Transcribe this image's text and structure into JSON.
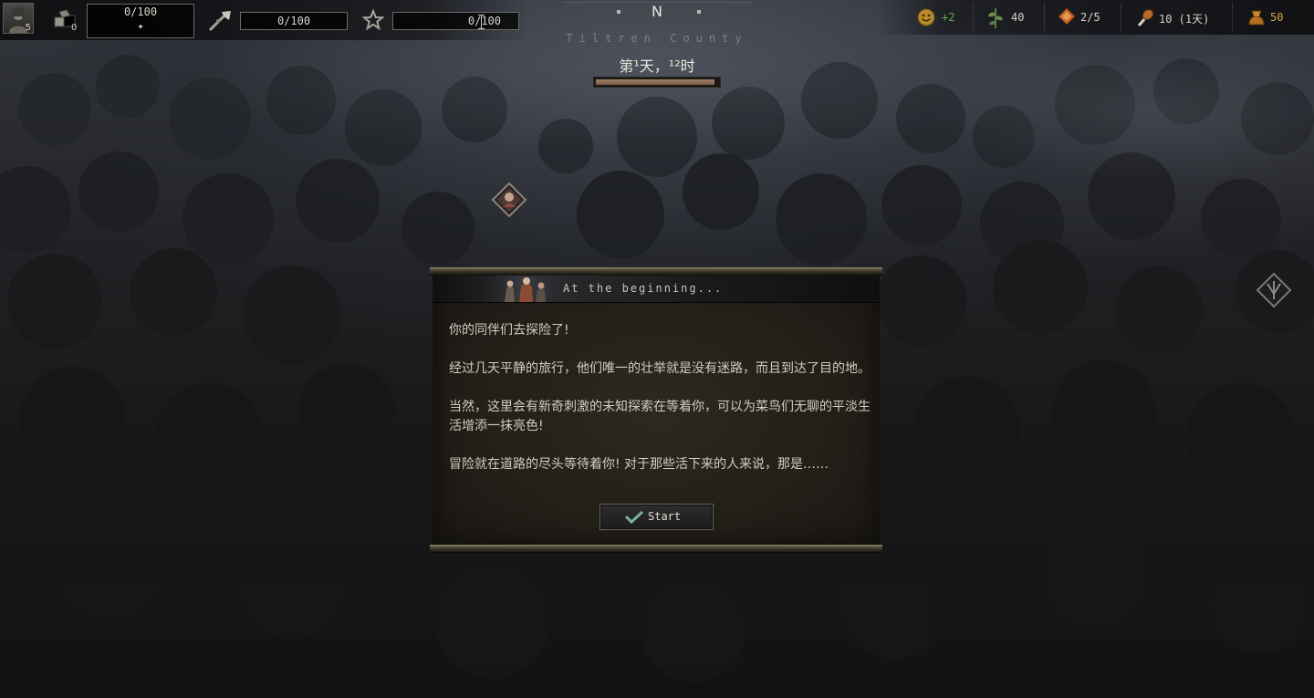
{
  "hud": {
    "portrait_count": "5",
    "supplies_count": "0",
    "supplies_value": "0/100",
    "supplies_sub": "✦",
    "weapon_value": "0/100",
    "fame_value": "0/100"
  },
  "compass": {
    "heading": "N"
  },
  "location": {
    "county": "Tiltren County"
  },
  "time": {
    "day_label": "第¹天，¹²时",
    "progress": 0.97
  },
  "resources": {
    "mood": {
      "value": "+2",
      "color": "#6aa84f",
      "icon": "smiley-icon"
    },
    "herbs": {
      "value": "40",
      "icon": "herb-icon"
    },
    "gems": {
      "value": "2/5",
      "icon": "gem-icon"
    },
    "food": {
      "value": "10 (1天)",
      "icon": "drumstick-icon"
    },
    "gold": {
      "value": "50",
      "color": "#d6a640",
      "icon": "gold-pouch-icon"
    }
  },
  "dialog": {
    "title": "At the beginning...",
    "paragraphs": [
      "你的同伴们去探险了!",
      "经过几天平静的旅行，他们唯一的壮举就是没有迷路，而且到达了目的地。",
      "当然，这里会有新奇刺激的未知探索在等着你，可以为菜鸟们无聊的平淡生活增添一抹亮色!",
      "冒险就在道路的尽头等待着你! 对于那些活下来的人来说，那是……"
    ],
    "start_label": "Start"
  },
  "colors": {
    "accent_gold": "#d6a640",
    "text_light": "#d2cdc2",
    "positive": "#6aa84f"
  }
}
